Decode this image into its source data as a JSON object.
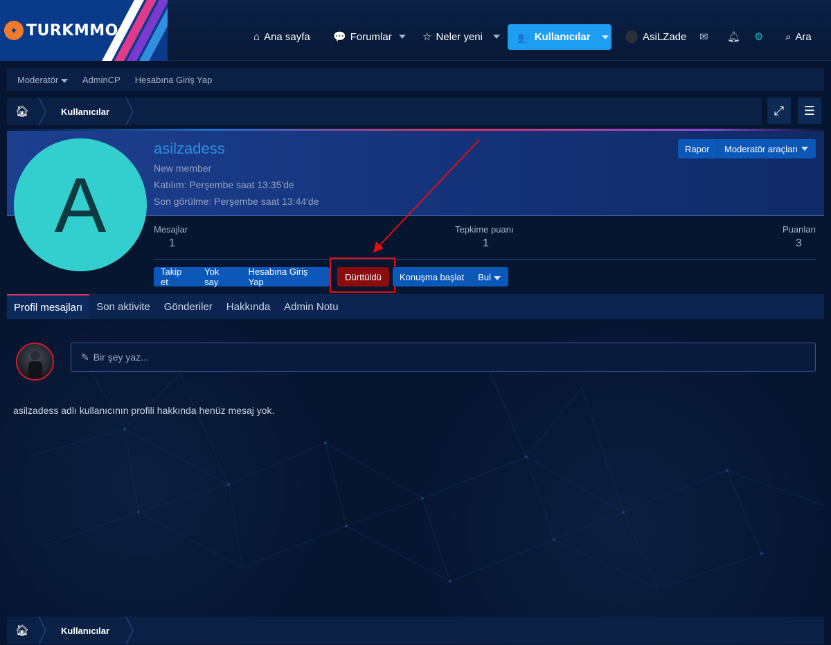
{
  "header": {
    "logo_text": "TURKMMO",
    "nav": {
      "home": "Ana sayfa",
      "forums": "Forumlar",
      "whats_new": "Neler yeni",
      "members": "Kullanıcılar",
      "username": "AsiLZade",
      "search": "Ara"
    }
  },
  "subnav": {
    "moderator": "Moderatör",
    "admincp": "AdminCP",
    "login_as": "Hesabına Giriş Yap"
  },
  "breadcrumb": {
    "members": "Kullanıcılar"
  },
  "profile": {
    "avatar_letter": "A",
    "username": "asilzadess",
    "title": "New member",
    "joined": "Katılım: Perşembe saat 13:35'de",
    "last_seen": "Son görülme: Perşembe saat 13:44'de",
    "report_label": "Rapor",
    "mod_tools_label": "Moderatör araçları",
    "stats": [
      {
        "label": "Mesajlar",
        "value": "1"
      },
      {
        "label": "Tepkime puanı",
        "value": "1"
      },
      {
        "label": "Puanları",
        "value": "3"
      }
    ],
    "actions": {
      "follow": "Takip et",
      "ignore": "Yok say",
      "login_as": "Hesabına Giriş Yap",
      "poked": "Dürttüldü",
      "start_conversation": "Konuşma başlat",
      "find": "Bul"
    }
  },
  "tabs": [
    "Profil mesajları",
    "Son aktivite",
    "Gönderiler",
    "Hakkında",
    "Admin Notu"
  ],
  "composer": {
    "placeholder": "Bir şey yaz..."
  },
  "empty_message": "asilzadess adlı kullanıcının profili hakkında henüz mesaj yok.",
  "colors": {
    "background": "#061530",
    "accent": "#1e9ef0",
    "poke": "#8a0d0d",
    "highlight": "#e01010",
    "avatar": "#33cfcf"
  }
}
